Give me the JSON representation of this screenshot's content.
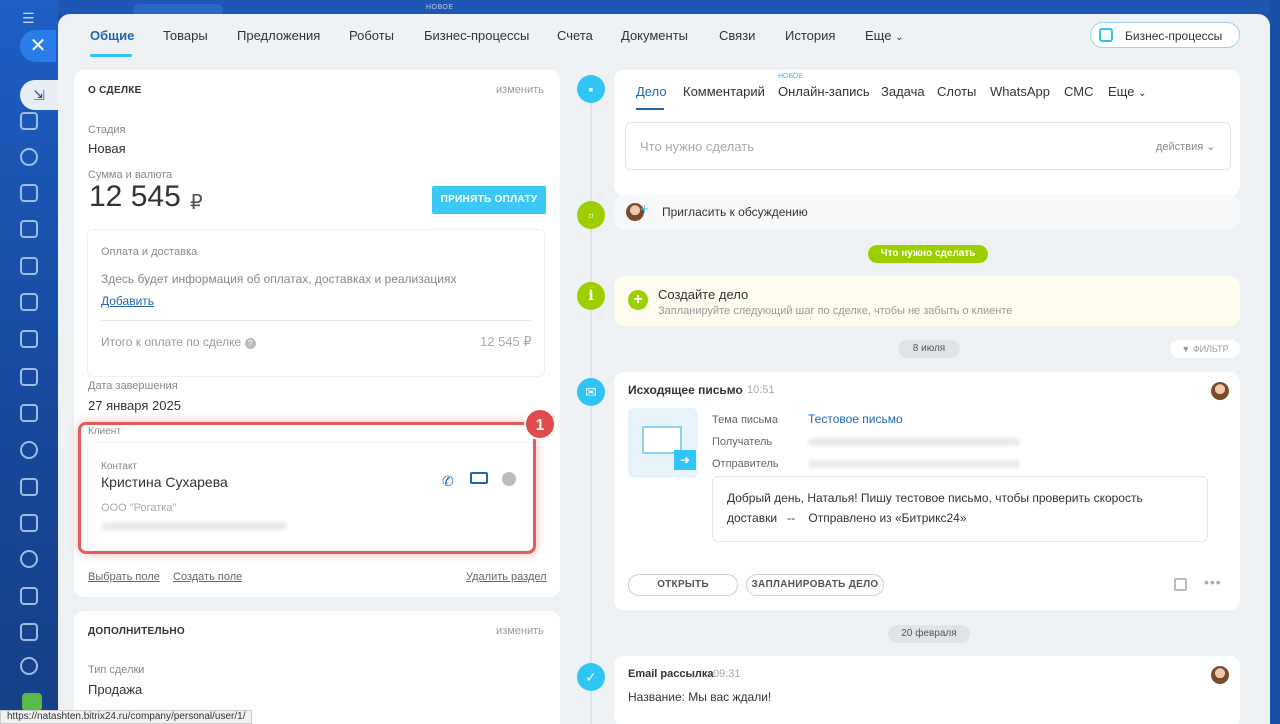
{
  "top_tabs": {
    "items": [
      "Общие",
      "Товары",
      "Предложения",
      "Роботы",
      "Бизнес-процессы",
      "Счета",
      "Документы",
      "Связи",
      "История",
      "Еще"
    ],
    "bp_button": "Бизнес-процессы",
    "new_tag": "НОВОЕ"
  },
  "deal": {
    "section_title": "О СДЕЛКЕ",
    "edit": "изменить",
    "stage_label": "Стадия",
    "stage_value": "Новая",
    "sum_label": "Сумма и валюта",
    "amount": "12 545",
    "currency": "₽",
    "pay_button": "ПРИНЯТЬ ОПЛАТУ",
    "payment_title": "Оплата и доставка",
    "payment_info": "Здесь будет информация об оплатах, доставках и реализациях",
    "add_link": "Добавить",
    "total_label": "Итого к оплате по сделке",
    "total_value": "12 545 ₽",
    "close_date_label": "Дата завершения",
    "close_date": "27 января 2025",
    "client_label": "Клиент",
    "contact_label": "Контакт",
    "contact_name": "Кристина Сухарева",
    "company": "ООО \"Рогатка\"",
    "choose_field": "Выбрать поле",
    "create_field": "Создать поле",
    "delete_section": "Удалить раздел",
    "badge": "1"
  },
  "extra": {
    "section_title": "ДОПОЛНИТЕЛЬНО",
    "edit": "изменить",
    "type_label": "Тип сделки",
    "type_value": "Продажа"
  },
  "activity": {
    "tabs": [
      "Дело",
      "Комментарий",
      "Онлайн-запись",
      "Задача",
      "Слоты",
      "WhatsApp",
      "СМС",
      "Еще"
    ],
    "new_tag": "НОВОЕ",
    "placeholder": "Что нужно сделать",
    "actions": "действия",
    "invite": "Пригласить к обсуждению",
    "todo_pill": "Что нужно сделать",
    "create_title": "Создайте дело",
    "create_hint": "Запланируйте следующий шаг по сделке, чтобы не забыть о клиенте",
    "date1": "8 июля",
    "filter": "ФИЛЬТР",
    "mail_title": "Исходящее письмо",
    "mail_time": "10:51",
    "subject_label": "Тема письма",
    "subject_value": "Тестовое письмо",
    "to_label": "Получатель",
    "from_label": "Отправитель",
    "body_line1": "Добрый день, Наталья!  Пишу тестовое письмо, чтобы проверить скорость",
    "body_line2": "доставки   --    Отправлено из «Битрикс24»",
    "open_btn": "ОТКРЫТЬ",
    "plan_btn": "ЗАПЛАНИРОВАТЬ ДЕЛО",
    "date2": "20 февраля",
    "mailing_title": "Email рассылка",
    "mailing_time": "09:31",
    "mailing_name": "Название: Мы вас ждали!"
  },
  "status_url": "https://natashten.bitrix24.ru/company/personal/user/1/"
}
